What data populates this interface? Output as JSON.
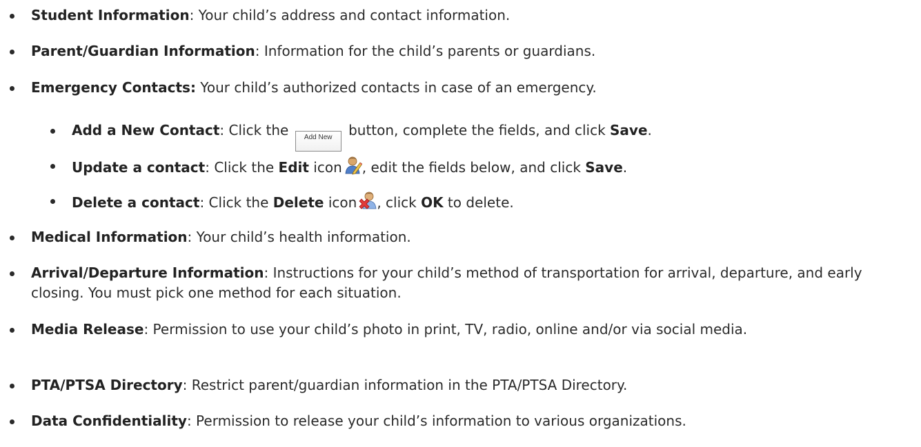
{
  "items": [
    {
      "title": "Student Information",
      "sep": ":",
      "text": " Your child’s address and contact information."
    },
    {
      "title": "Parent/Guardian Information",
      "sep": ":",
      "text": " Information for the child’s parents or guardians."
    },
    {
      "title": "Emergency Contacts:",
      "sep": "",
      "text": " Your child’s authorized contacts in case of an emergency."
    }
  ],
  "sub_items": {
    "add": {
      "title": "Add a New Contact",
      "sep": ":",
      "pre": " Click the",
      "button_label": "Add New",
      "post": " button, complete the fields, and click ",
      "strong": "Save",
      "end": "."
    },
    "update": {
      "title": "Update a contact",
      "sep": ":",
      "pre": " Click the ",
      "strong1": "Edit",
      "mid": " icon",
      "icon": "edit-contact-icon",
      "post": ", edit the fields below, and click ",
      "strong2": "Save",
      "end": "."
    },
    "delete": {
      "title": "Delete a contact",
      "sep": ":",
      "pre": " Click the ",
      "strong1": "Delete",
      "mid": " icon",
      "icon": "delete-contact-icon",
      "post": ", click ",
      "strong2": "OK",
      "end": " to delete."
    }
  },
  "items_after": [
    {
      "title": "Medical Information",
      "sep": ":",
      "text": " Your child’s health information."
    },
    {
      "title": "Arrival/Departure Information",
      "sep": ":",
      "text": " Instructions for your child’s method of transportation for arrival, departure, and early closing. You must pick one method for each situation."
    },
    {
      "title": "Media Release",
      "sep": ":",
      "text": " Permission to use your child’s photo in print, TV, radio, online and/or via social media."
    },
    {
      "title": "PTA/PTSA Directory",
      "sep": ":",
      "text": " Restrict parent/guardian information in the PTA/PTSA Directory."
    },
    {
      "title": "Data Confidentiality",
      "sep": ":",
      "text": " Permission to release your child’s information to various organizations."
    }
  ]
}
